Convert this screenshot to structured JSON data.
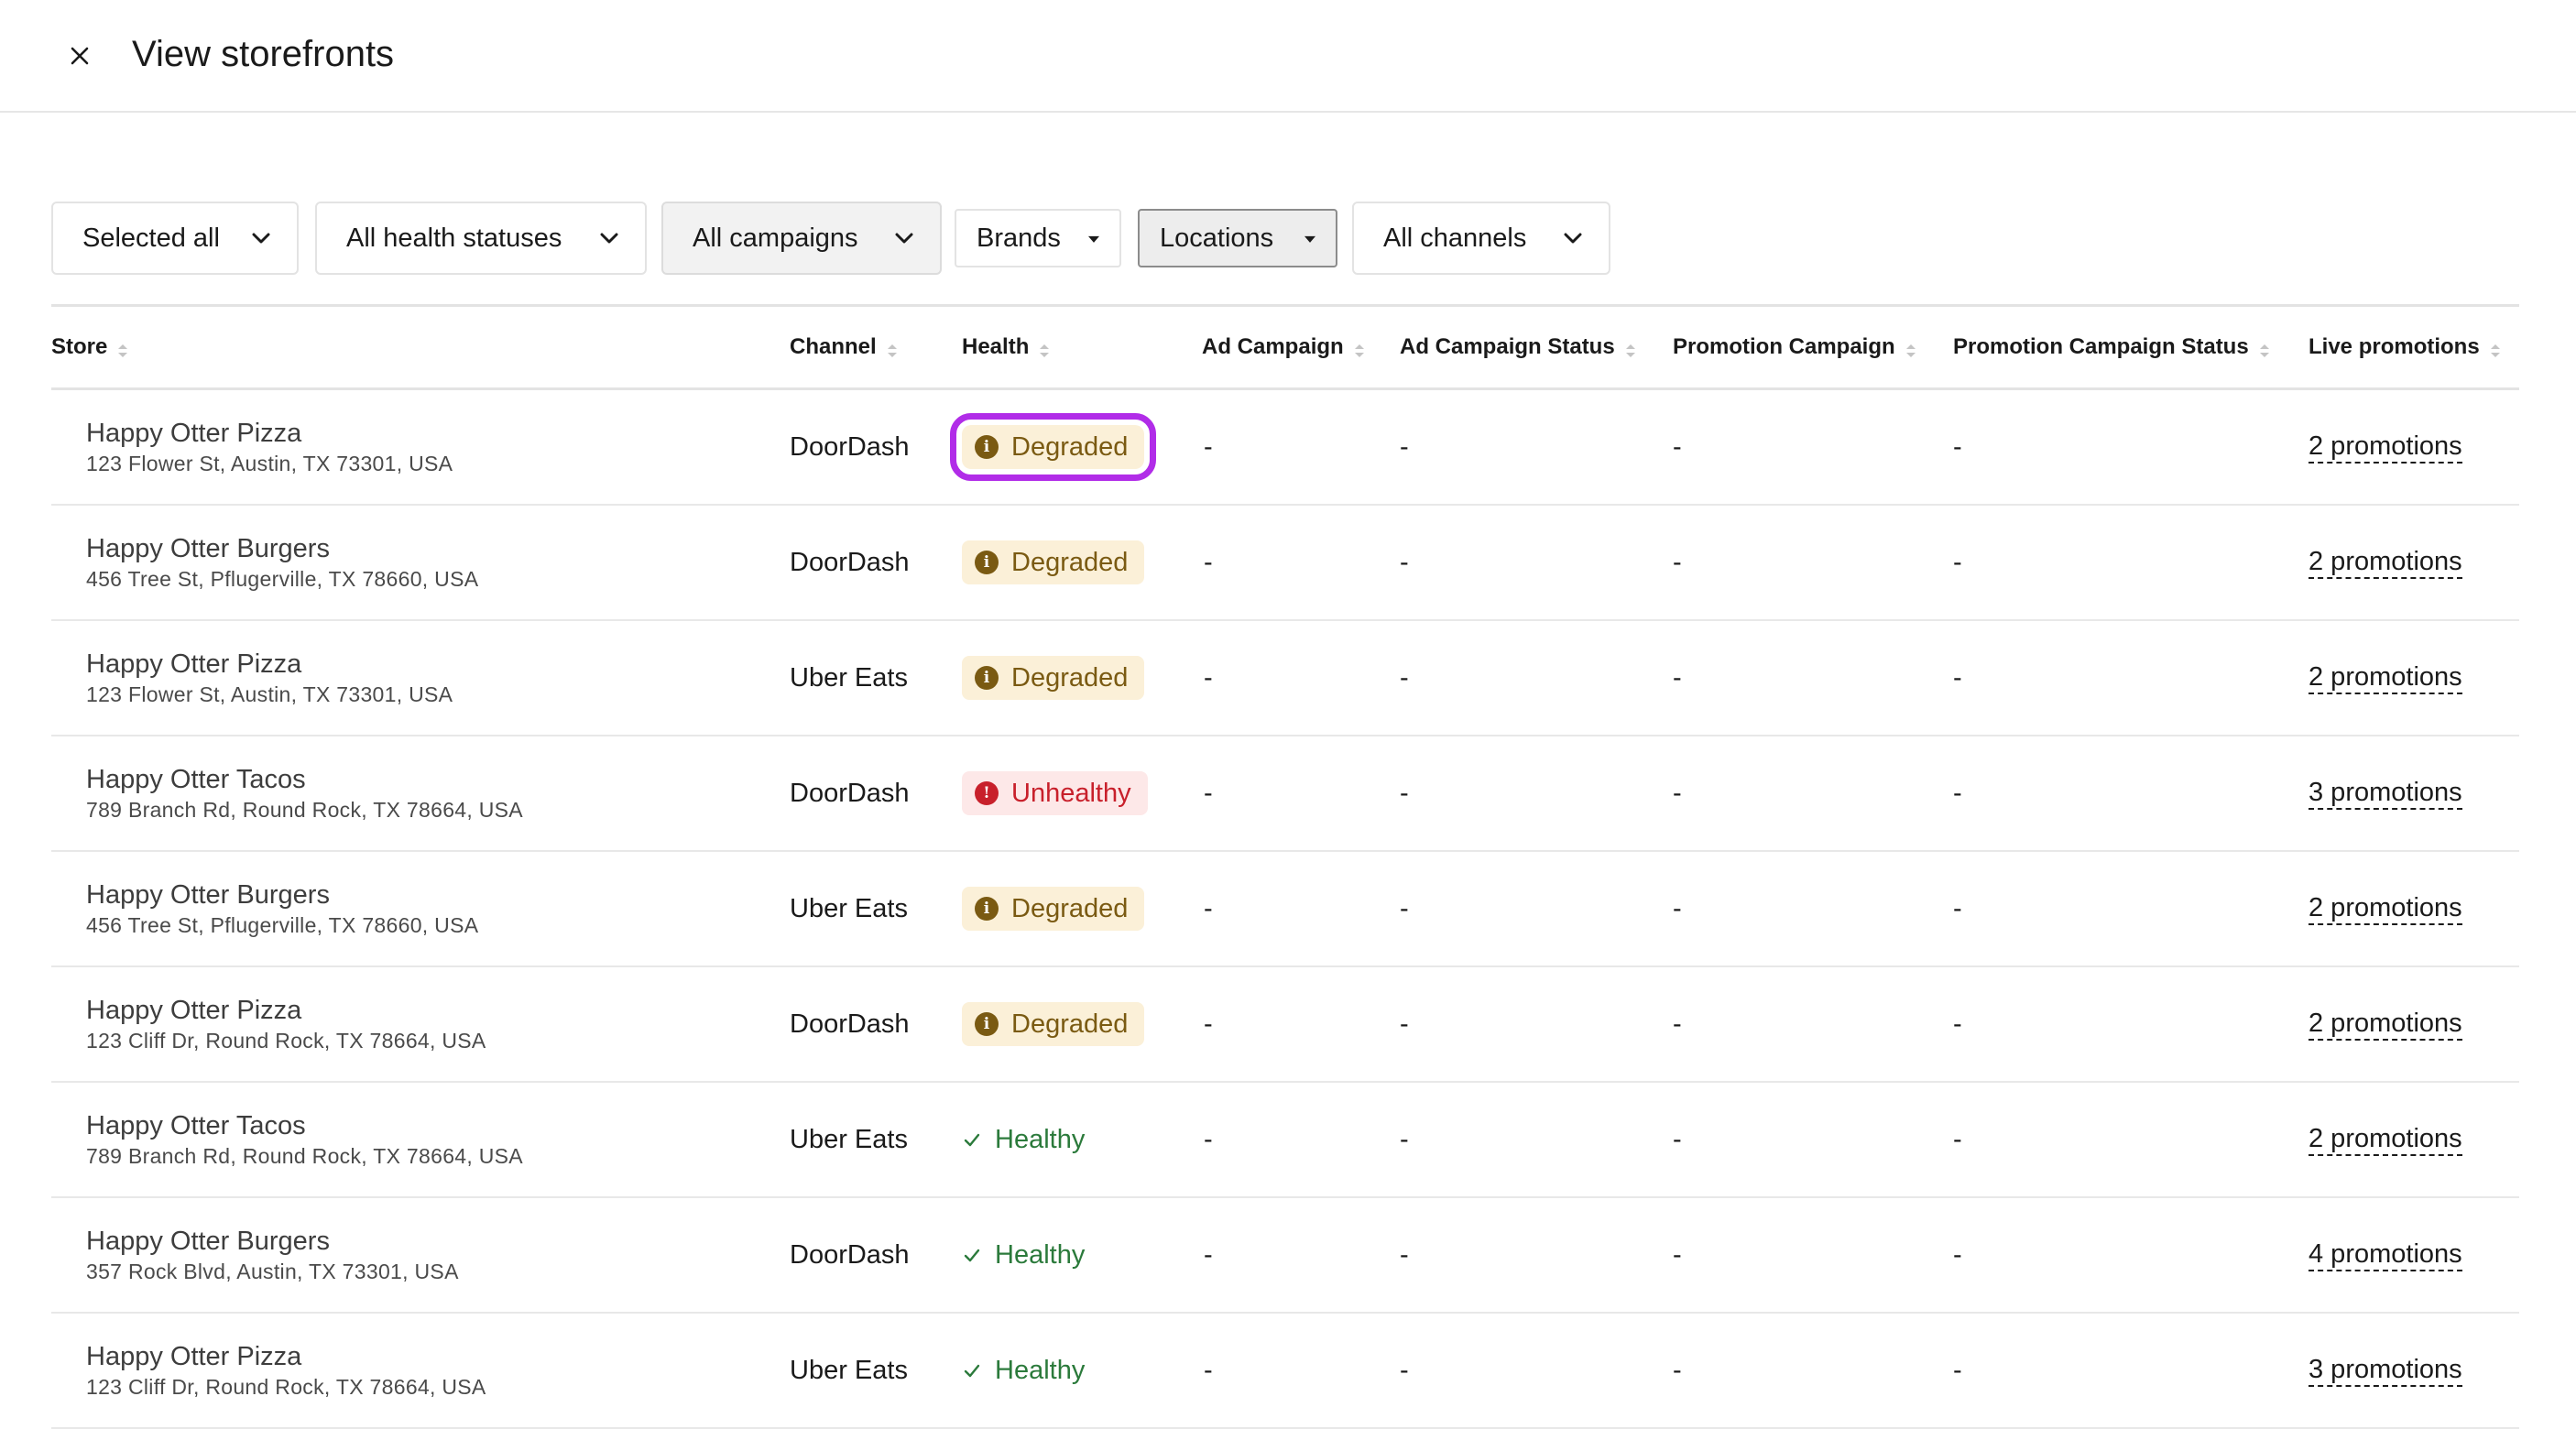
{
  "header": {
    "title": "View storefronts",
    "close_icon": "close-icon"
  },
  "filters": [
    {
      "label": "Selected all",
      "icon": "chevron-down-icon"
    },
    {
      "label": "All health statuses",
      "icon": "chevron-down-icon"
    },
    {
      "label": "All campaigns",
      "icon": "chevron-down-icon"
    },
    {
      "label": "Brands",
      "icon": "caret-down-icon"
    },
    {
      "label": "Locations",
      "icon": "caret-down-icon"
    },
    {
      "label": "All channels",
      "icon": "chevron-down-icon"
    }
  ],
  "table": {
    "columns": [
      "Store",
      "Channel",
      "Health",
      "Ad Campaign",
      "Ad Campaign Status",
      "Promotion Campaign",
      "Promotion Campaign Status",
      "Live promotions"
    ],
    "rows": [
      {
        "name": "Happy Otter Pizza",
        "address": "123 Flower St, Austin, TX 73301, USA",
        "channel": "DoorDash",
        "health": "Degraded",
        "ad_campaign": "-",
        "ad_campaign_status": "-",
        "promotion_campaign": "-",
        "promotion_campaign_status": "-",
        "live_promotions": "2 promotions"
      },
      {
        "name": "Happy Otter Burgers",
        "address": "456 Tree St, Pflugerville, TX 78660, USA",
        "channel": "DoorDash",
        "health": "Degraded",
        "ad_campaign": "-",
        "ad_campaign_status": "-",
        "promotion_campaign": "-",
        "promotion_campaign_status": "-",
        "live_promotions": "2 promotions"
      },
      {
        "name": "Happy Otter Pizza",
        "address": "123 Flower St, Austin, TX 73301, USA",
        "channel": "Uber Eats",
        "health": "Degraded",
        "ad_campaign": "-",
        "ad_campaign_status": "-",
        "promotion_campaign": "-",
        "promotion_campaign_status": "-",
        "live_promotions": "2 promotions"
      },
      {
        "name": "Happy Otter Tacos",
        "address": "789 Branch Rd, Round Rock, TX 78664, USA",
        "channel": "DoorDash",
        "health": "Unhealthy",
        "ad_campaign": "-",
        "ad_campaign_status": "-",
        "promotion_campaign": "-",
        "promotion_campaign_status": "-",
        "live_promotions": "3 promotions"
      },
      {
        "name": "Happy Otter Burgers",
        "address": "456 Tree St, Pflugerville, TX 78660, USA",
        "channel": "Uber Eats",
        "health": "Degraded",
        "ad_campaign": "-",
        "ad_campaign_status": "-",
        "promotion_campaign": "-",
        "promotion_campaign_status": "-",
        "live_promotions": "2 promotions"
      },
      {
        "name": "Happy Otter Pizza",
        "address": "123 Cliff Dr, Round Rock, TX 78664, USA",
        "channel": "DoorDash",
        "health": "Degraded",
        "ad_campaign": "-",
        "ad_campaign_status": "-",
        "promotion_campaign": "-",
        "promotion_campaign_status": "-",
        "live_promotions": "2 promotions"
      },
      {
        "name": "Happy Otter Tacos",
        "address": "789 Branch Rd, Round Rock, TX 78664, USA",
        "channel": "Uber Eats",
        "health": "Healthy",
        "ad_campaign": "-",
        "ad_campaign_status": "-",
        "promotion_campaign": "-",
        "promotion_campaign_status": "-",
        "live_promotions": "2 promotions"
      },
      {
        "name": "Happy Otter Burgers",
        "address": "357 Rock Blvd, Austin, TX 73301, USA",
        "channel": "DoorDash",
        "health": "Healthy",
        "ad_campaign": "-",
        "ad_campaign_status": "-",
        "promotion_campaign": "-",
        "promotion_campaign_status": "-",
        "live_promotions": "4 promotions"
      },
      {
        "name": "Happy Otter Pizza",
        "address": "123 Cliff Dr, Round Rock, TX 78664, USA",
        "channel": "Uber Eats",
        "health": "Healthy",
        "ad_campaign": "-",
        "ad_campaign_status": "-",
        "promotion_campaign": "-",
        "promotion_campaign_status": "-",
        "live_promotions": "3 promotions"
      }
    ]
  },
  "health_styles": {
    "Degraded": {
      "color": "#7a5a12",
      "background": "#fbf0d8",
      "icon": "info-icon"
    },
    "Unhealthy": {
      "color": "#c8202b",
      "background": "#fde8e8",
      "icon": "error-icon"
    },
    "Healthy": {
      "color": "#2b7a3b",
      "icon": "check-icon"
    }
  },
  "highlight_color": "#b12ce8"
}
